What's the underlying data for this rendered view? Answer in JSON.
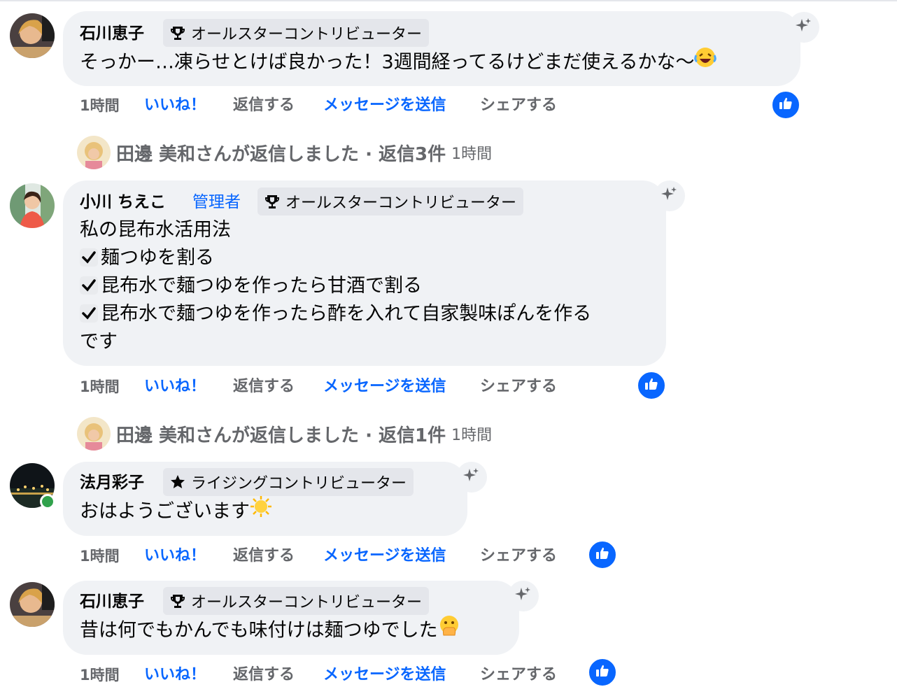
{
  "comments": [
    {
      "author": "石川恵子",
      "badge": "オールスターコントリビューター",
      "badge_icon": "trophy-icon",
      "lines": [
        "そっかー…凍らせとけば良かった！3週間経ってるけどまだ使えるかな〜"
      ],
      "emoji": "laughing-crying-emoji",
      "time": "1時間",
      "like": "いいね！",
      "reply": "返信する",
      "message": "メッセージを送信",
      "share": "シェアする",
      "reaction": "like"
    },
    {
      "author": "小川 ちえこ",
      "role": "管理者",
      "badge": "オールスターコントリビューター",
      "badge_icon": "trophy-icon",
      "lines": [
        "私の昆布水活用法",
        "麺つゆを割る",
        "昆布水で麺つゆを作ったら甘酒で割る",
        "昆布水で麺つゆを作ったら酢を入れて自家製味ぽんを作る",
        "です"
      ],
      "time": "1時間",
      "like": "いいね！",
      "reply": "返信する",
      "message": "メッセージを送信",
      "share": "シェアする",
      "reaction": "like"
    },
    {
      "author": "法月彩子",
      "badge": "ライジングコントリビューター",
      "badge_icon": "star-icon",
      "lines": [
        "おはようございます"
      ],
      "emoji": "sun-emoji",
      "online": true,
      "time": "1時間",
      "like": "いいね！",
      "reply": "返信する",
      "message": "メッセージを送信",
      "share": "シェアする",
      "reaction": "like"
    },
    {
      "author": "石川恵子",
      "badge": "オールスターコントリビューター",
      "badge_icon": "trophy-icon",
      "lines": [
        "昔は何でもかんでも味付けは麺つゆでした"
      ],
      "emoji": "hand-over-mouth-emoji",
      "time": "1時間",
      "like": "いいね！",
      "reply": "返信する",
      "message": "メッセージを送信",
      "share": "シェアする",
      "reaction": "like"
    }
  ],
  "reply_summaries": [
    {
      "text": "田邊 美和さんが返信しました · 返信3件",
      "time": "1時間"
    },
    {
      "text": "田邊 美和さんが返信しました · 返信1件",
      "time": "1時間"
    }
  ],
  "colors": {
    "link": "#0866ff",
    "bubble": "#f0f2f5",
    "badge": "#e4e6eb",
    "muted": "#65676b",
    "online": "#31a24c"
  }
}
